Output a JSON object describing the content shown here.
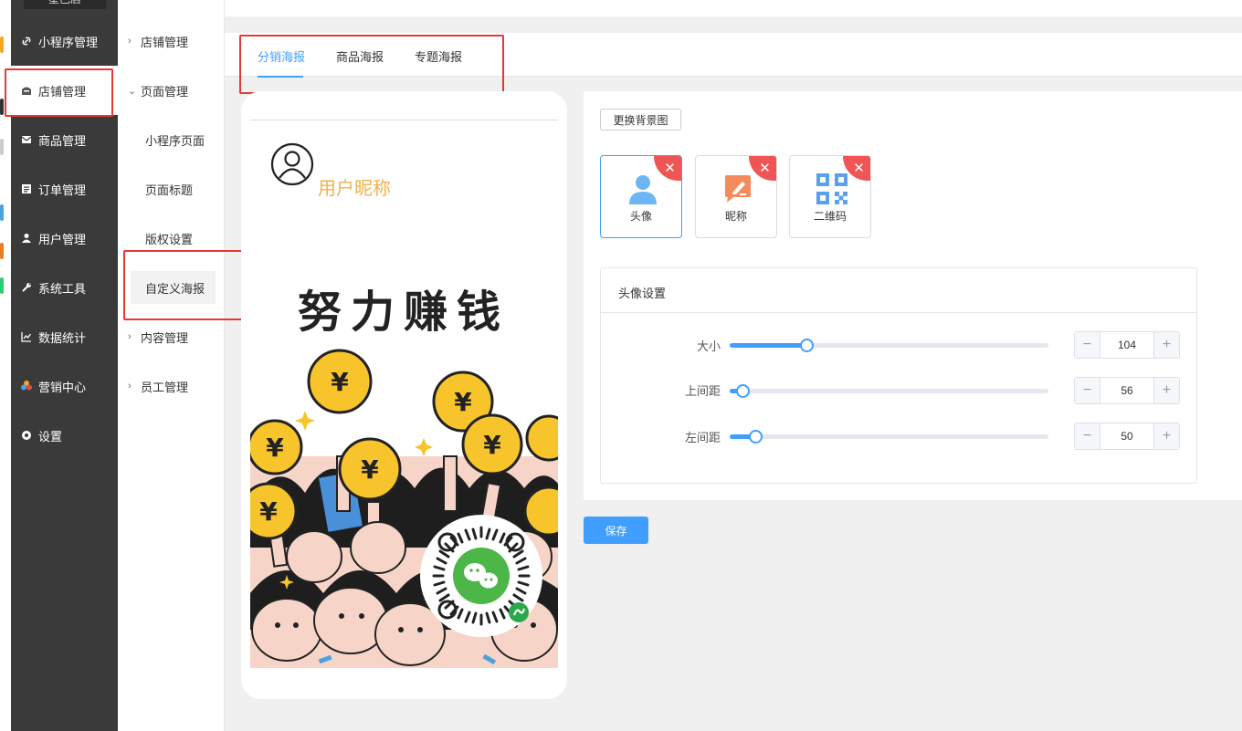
{
  "sidebar": {
    "brand": "星巴店",
    "items": [
      {
        "label": "小程序管理",
        "icon": "link-icon"
      },
      {
        "label": "店铺管理",
        "icon": "store-icon"
      },
      {
        "label": "商品管理",
        "icon": "mail-icon"
      },
      {
        "label": "订单管理",
        "icon": "list-icon"
      },
      {
        "label": "用户管理",
        "icon": "user-icon"
      },
      {
        "label": "系统工具",
        "icon": "wrench-icon"
      },
      {
        "label": "数据统计",
        "icon": "chart-icon"
      },
      {
        "label": "营销中心",
        "icon": "pinwheel-icon"
      },
      {
        "label": "设置",
        "icon": "gear-icon"
      }
    ]
  },
  "submenu": {
    "store": "店铺管理",
    "page": "页面管理",
    "page_children": [
      "小程序页面",
      "页面标题",
      "版权设置",
      "自定义海报"
    ],
    "content": "内容管理",
    "staff": "员工管理"
  },
  "tabs": [
    "分销海报",
    "商品海报",
    "专题海报"
  ],
  "preview": {
    "nickname": "用户昵称",
    "poster_slogan": "努力赚钱",
    "coin_symbol": "¥"
  },
  "panel": {
    "change_bg_button": "更换背景图",
    "elements": [
      {
        "label": "头像",
        "icon": "avatar-icon"
      },
      {
        "label": "昵称",
        "icon": "edit-icon"
      },
      {
        "label": "二维码",
        "icon": "qrcode-icon"
      }
    ],
    "settings_title": "头像设置",
    "rows": [
      {
        "label": "大小",
        "value": "104",
        "level": 0.24
      },
      {
        "label": "上间距",
        "value": "56",
        "level": 0.04
      },
      {
        "label": "左间距",
        "value": "50",
        "level": 0.08
      }
    ]
  },
  "save_button": "保存",
  "colors": {
    "accent": "#409eff",
    "sidebar": "#3a3a3a",
    "danger": "#f05454",
    "nickname": "#f0b24a"
  }
}
